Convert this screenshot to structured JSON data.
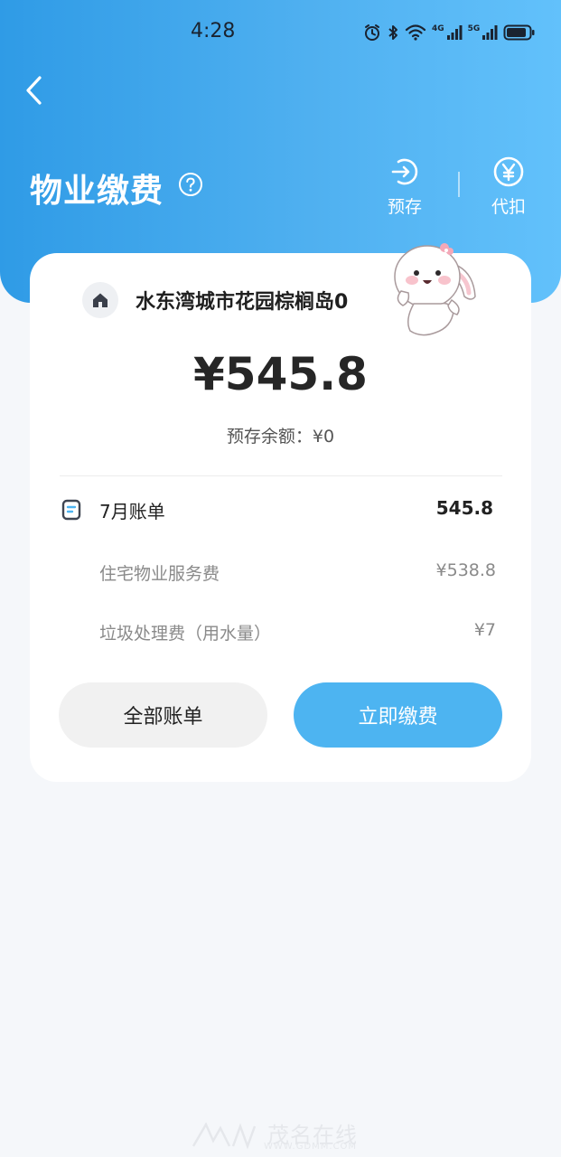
{
  "status_bar": {
    "time": "4:28",
    "network_1": "4G",
    "network_2": "5G"
  },
  "header": {
    "title": "物业缴费",
    "actions": [
      {
        "label": "预存",
        "icon": "arrow-right-circle-icon"
      },
      {
        "label": "代扣",
        "icon": "yen-circle-icon"
      }
    ]
  },
  "card": {
    "address": "水东湾城市花园棕榈岛0",
    "total": "¥545.8",
    "balance_label": "预存余额：",
    "balance_value": "¥0",
    "bill": {
      "title": "7月账单",
      "amount": "545.8",
      "items": [
        {
          "name": "住宅物业服务费",
          "amount": "¥538.8"
        },
        {
          "name": "垃圾处理费（用水量）",
          "amount": "¥7"
        }
      ]
    },
    "buttons": {
      "all_bills": "全部账单",
      "pay_now": "立即缴费"
    }
  },
  "watermark": {
    "text": "茂名在线",
    "url": "WWW.GDMM.COM"
  },
  "colors": {
    "header_start": "#2f9be6",
    "header_end": "#62c1fb",
    "primary_button": "#4db4f1",
    "page_bg": "#f5f7fa"
  }
}
